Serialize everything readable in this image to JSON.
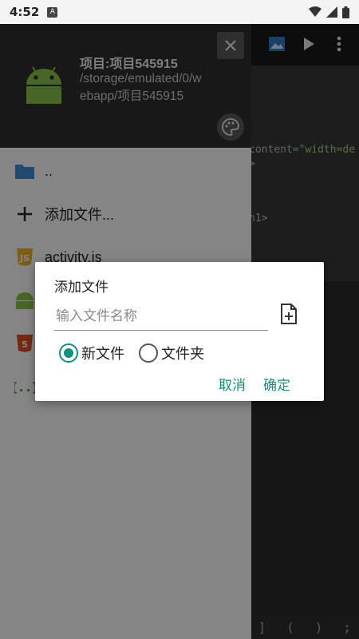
{
  "status_bar": {
    "time": "4:52",
    "sim_icon_label": "A"
  },
  "editor": {
    "code_lines": [
      {
        "text": "content=\"width=de",
        "highlight": "\"width=de"
      },
      {
        "text": ">"
      },
      {
        "text": "h1>"
      }
    ],
    "bottom_symbols": [
      "]",
      "(",
      ")",
      ";"
    ]
  },
  "drawer": {
    "project_title": "项目:项目545915",
    "project_path": "/storage/emulated/0/webapp/项目545915",
    "items": [
      {
        "label": "..",
        "icon": "folder-icon"
      },
      {
        "label": "添加文件...",
        "icon": "plus-icon"
      },
      {
        "label": "activity.js",
        "icon": "js-icon"
      },
      {
        "label": "",
        "icon": "android-icon"
      },
      {
        "label": "",
        "icon": "html5-icon"
      },
      {
        "label": "",
        "icon": "json-icon"
      }
    ]
  },
  "dialog": {
    "title": "添加文件",
    "input_placeholder": "输入文件名称",
    "input_value": "",
    "radio_options": [
      {
        "label": "新文件",
        "checked": true
      },
      {
        "label": "文件夹",
        "checked": false
      }
    ],
    "cancel_label": "取消",
    "confirm_label": "确定"
  },
  "colors": {
    "accent": "#15907a",
    "drawer_header": "#2e2e2e",
    "android_green": "#8bc34a"
  }
}
